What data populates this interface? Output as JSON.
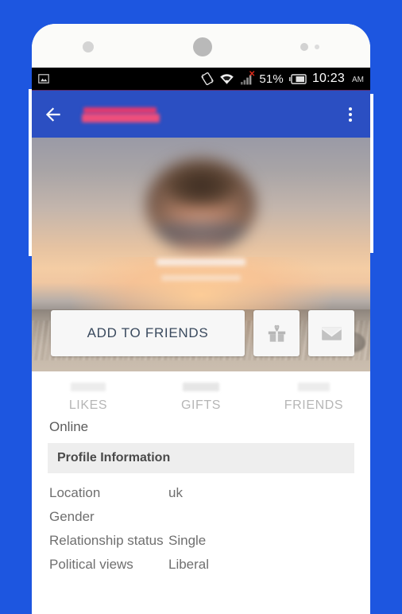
{
  "statusbar": {
    "notification_icon": "image-notification-icon",
    "rotation_icon": "auto-rotate-off-icon",
    "wifi_icon": "wifi-icon",
    "signal_icon": "signal-no-service-icon",
    "battery_percent": "51%",
    "battery_icon": "battery-icon",
    "time": "10:23",
    "ampm": "AM"
  },
  "appbar": {
    "back_icon": "back-arrow-icon",
    "title": "",
    "overflow_icon": "overflow-menu-icon",
    "color": "#2b4fc2"
  },
  "hero": {
    "avatar_name": "profile-avatar",
    "display_name": "",
    "actions": {
      "add_label": "ADD TO FRIENDS",
      "gift_icon": "gift-icon",
      "message_icon": "envelope-icon"
    }
  },
  "stats": [
    {
      "label": "LIKES",
      "count": ""
    },
    {
      "label": "GIFTS",
      "count": ""
    },
    {
      "label": "FRIENDS",
      "count": ""
    }
  ],
  "status": {
    "online": "Online"
  },
  "profile_information": {
    "header": "Profile Information",
    "rows": [
      {
        "key": "Location",
        "value": "uk"
      },
      {
        "key": "Gender",
        "value": ""
      },
      {
        "key": "Relationship status",
        "value": "Single"
      },
      {
        "key": "Political views",
        "value": "Liberal"
      }
    ]
  },
  "colors": {
    "page_background": "#1d56e0",
    "appbar": "#2b4fc2",
    "section_header_bg": "#eeeeee",
    "button_bg": "#f7f7f7"
  }
}
